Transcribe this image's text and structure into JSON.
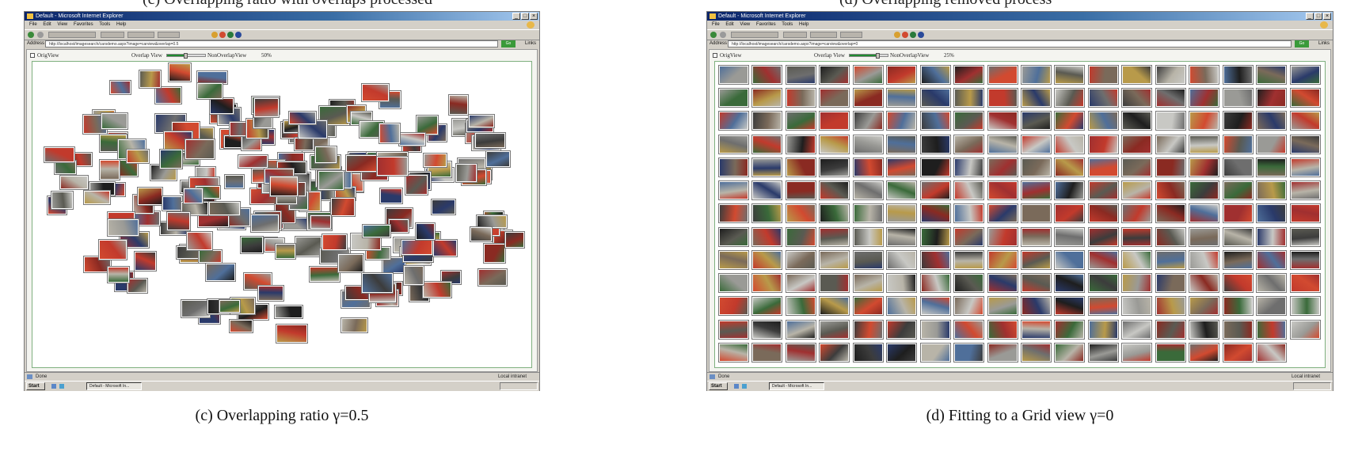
{
  "top_cutoff_text": {
    "left": "(c) Overlapping ratio with overlaps processed",
    "right": "(d) Overlapping removed process"
  },
  "panels": {
    "c": {
      "window_title": "Default - Microsoft Internet Explorer",
      "menu": [
        "File",
        "Edit",
        "View",
        "Favorites",
        "Tools",
        "Help"
      ],
      "toolbar_text": "Back  ·  Search  Favorites  Media",
      "address_label": "Address",
      "address_value": "http://localhost/imagesearch/carsdemo.aspx?image=carview&overlap=0.5",
      "go_label": "Go",
      "links_label": "Links",
      "controls": {
        "orig_view": "OrigView",
        "overlap_view": "Overlap View",
        "non_overlap_view": "NonOverlapView",
        "percent": "50%",
        "slider_fraction": 0.5
      },
      "status_text": "Done",
      "zone_text": "Local intranet",
      "taskbar": {
        "start": "Start",
        "task": "Default - Microsoft In..."
      },
      "caption": "(c) Overlapping ratio γ=0.5"
    },
    "d": {
      "window_title": "Default - Microsoft Internet Explorer",
      "menu": [
        "File",
        "Edit",
        "View",
        "Favorites",
        "Tools",
        "Help"
      ],
      "toolbar_text": "Back  ·  Search  Favorites  Media",
      "address_label": "Address",
      "address_value": "http://localhost/imagesearch/carsdemo.aspx?image=carview&overlap=0",
      "go_label": "Go",
      "links_label": "Links",
      "controls": {
        "orig_view": "OrigView",
        "overlap_view": "Overlap View",
        "non_overlap_view": "NonOverlapView",
        "percent": "25%",
        "slider_fraction": 0.75
      },
      "status_text": "Done",
      "zone_text": "Local intranet",
      "taskbar": {
        "start": "Start",
        "task": "Default - Microsoft In..."
      },
      "caption": "(d) Fitting to a Grid view γ=0"
    }
  },
  "thumbnail_palette": [
    "#8a2a22",
    "#c23a2c",
    "#3c3c3c",
    "#6e6e6e",
    "#9a9a96",
    "#b8b4a8",
    "#2a3a6a",
    "#4f6f9a",
    "#b89a4a",
    "#1e1e1e",
    "#d24a30",
    "#5a5a52",
    "#7a6a5a",
    "#c8c8c4",
    "#3a6a3a",
    "#a03030"
  ]
}
